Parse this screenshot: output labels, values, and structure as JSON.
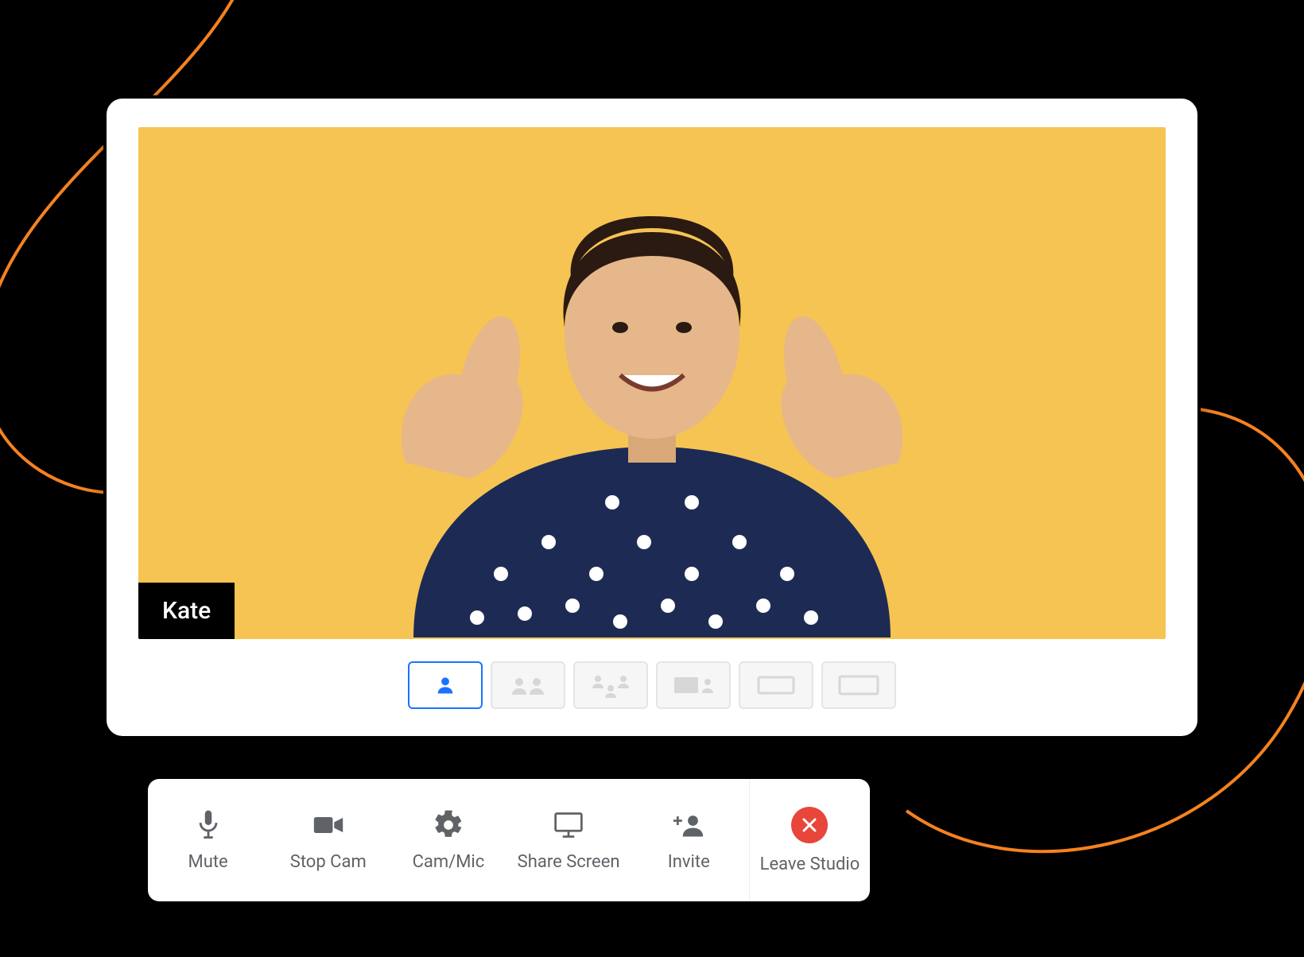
{
  "participant": {
    "name": "Kate"
  },
  "colors": {
    "video_bg": "#f6c453",
    "accent": "#1a73ff",
    "leave": "#e8463a",
    "swirl": "#f58220"
  },
  "layouts": {
    "active_index": 0,
    "count": 6
  },
  "toolbar": {
    "mute": "Mute",
    "stop_cam": "Stop Cam",
    "cam_mic": "Cam/Mic",
    "share_screen": "Share Screen",
    "invite": "Invite",
    "leave_studio": "Leave Studio"
  },
  "icons": {
    "mute": "mic-icon",
    "stop_cam": "video-icon",
    "cam_mic": "gear-icon",
    "share_screen": "screen-icon",
    "invite": "add-user-icon",
    "leave": "close-icon",
    "layout_single": "person-icon"
  }
}
